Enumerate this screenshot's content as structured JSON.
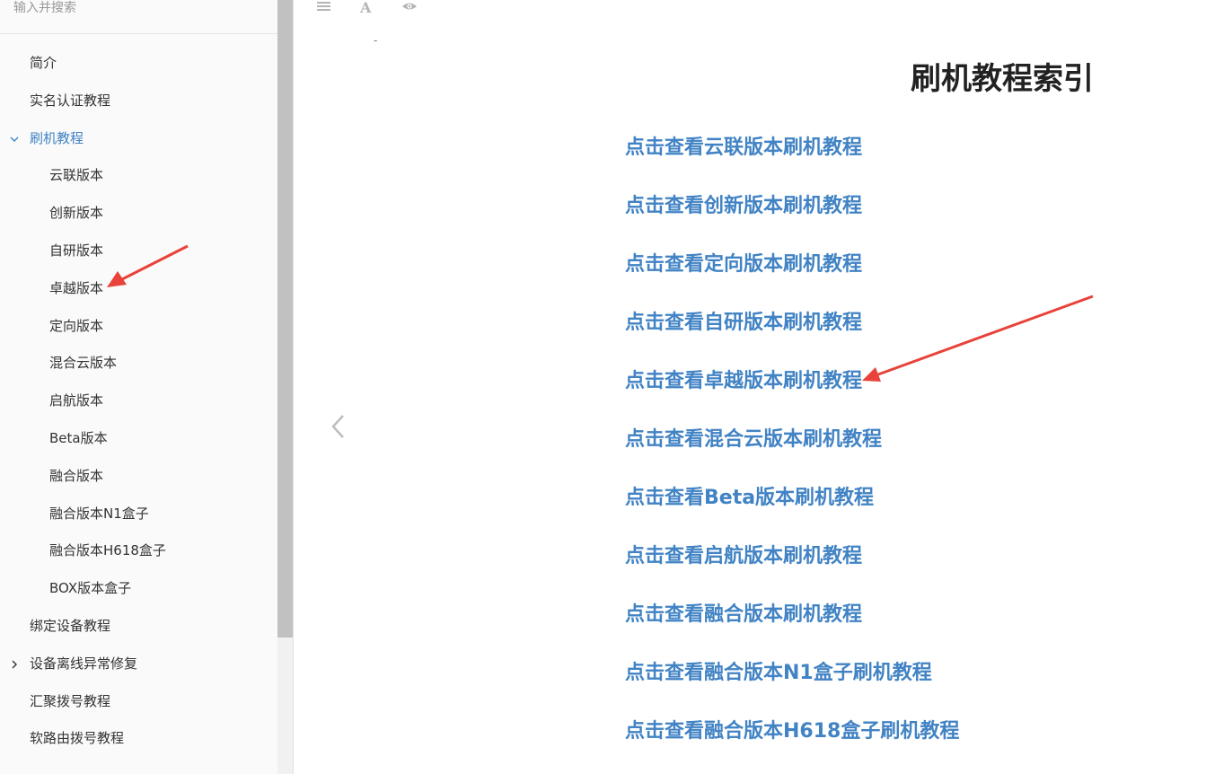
{
  "search": {
    "placeholder": "输入并搜索"
  },
  "sidebar": {
    "items": [
      {
        "label": "简介"
      },
      {
        "label": "实名认证教程"
      },
      {
        "label": "刷机教程"
      },
      {
        "label": "云联版本"
      },
      {
        "label": "创新版本"
      },
      {
        "label": "自研版本"
      },
      {
        "label": "卓越版本"
      },
      {
        "label": "定向版本"
      },
      {
        "label": "混合云版本"
      },
      {
        "label": "启航版本"
      },
      {
        "label": "Beta版本"
      },
      {
        "label": "融合版本"
      },
      {
        "label": "融合版本N1盒子"
      },
      {
        "label": "融合版本H618盒子"
      },
      {
        "label": "BOX版本盒子"
      },
      {
        "label": "绑定设备教程"
      },
      {
        "label": "设备离线异常修复"
      },
      {
        "label": "汇聚拨号教程"
      },
      {
        "label": "软路由拨号教程"
      }
    ]
  },
  "toolbar": {
    "dash": "-"
  },
  "main": {
    "title": "刷机教程索引",
    "links": [
      "点击查看云联版本刷机教程",
      "点击查看创新版本刷机教程",
      "点击查看定向版本刷机教程",
      "点击查看自研版本刷机教程",
      "点击查看卓越版本刷机教程",
      "点击查看混合云版本刷机教程",
      "点击查看Beta版本刷机教程",
      "点击查看启航版本刷机教程",
      "点击查看融合版本刷机教程",
      "点击查看融合版本N1盒子刷机教程",
      "点击查看融合版本H618盒子刷机教程"
    ]
  },
  "icons": {
    "toc": "list-icon",
    "font": "font-icon",
    "preview": "eye-icon",
    "expanded": "chevron-down-icon",
    "collapsed": "chevron-right-icon",
    "prev": "chevron-left-icon"
  },
  "colors": {
    "link": "#4183c4",
    "annotation": "#e8423a",
    "sidebar_bg": "#fafafa"
  }
}
